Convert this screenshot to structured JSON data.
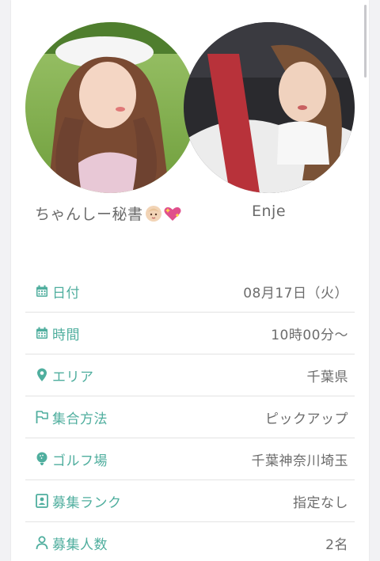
{
  "colors": {
    "accent": "#4fae9e",
    "label_text": "#4fae9e",
    "value_text": "#6c6c6c",
    "name_text": "#6a6a6a",
    "divider": "#e3e3e3"
  },
  "members": [
    {
      "name": "ちゃんしー秘書",
      "emojis": [
        "baby-emoji",
        "sparkling-heart-emoji"
      ]
    },
    {
      "name": "Enje"
    }
  ],
  "details": [
    {
      "icon": "calendar-icon",
      "label": "日付",
      "value": "08月17日（火）"
    },
    {
      "icon": "calendar-icon",
      "label": "時間",
      "value": "10時00分〜"
    },
    {
      "icon": "location-pin-icon",
      "label": "エリア",
      "value": "千葉県"
    },
    {
      "icon": "flag-icon",
      "label": "集合方法",
      "value": "ピックアップ"
    },
    {
      "icon": "golf-ball-icon",
      "label": "ゴルフ場",
      "value": "千葉神奈川埼玉"
    },
    {
      "icon": "id-card-icon",
      "label": "募集ランク",
      "value": "指定なし"
    },
    {
      "icon": "person-icon",
      "label": "募集人数",
      "value": "2名"
    }
  ]
}
